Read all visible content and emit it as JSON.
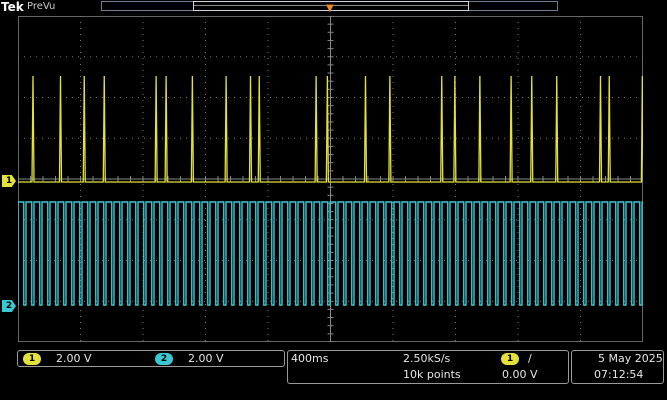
{
  "header": {
    "brand": "Tek",
    "mode": "PreVu"
  },
  "colors": {
    "ch1": "#e3e13a",
    "ch2": "#39c9d4",
    "trigger": "#f08a20",
    "grid": "#777777",
    "background": "#000000"
  },
  "icons": {
    "trigger_position": "trigger-marker-icon",
    "trigger_slope": "rising-edge-icon"
  },
  "channels": [
    {
      "number": "1",
      "scale": "2.00 V"
    },
    {
      "number": "2",
      "scale": "2.00 V"
    }
  ],
  "horizontal": {
    "time_per_div": "400ms",
    "sample_rate": "2.50kS/s",
    "record_length": "10k points"
  },
  "trigger": {
    "source": "1",
    "slope": "/",
    "level": "0.00 V"
  },
  "datetime": {
    "date": "5 May 2025",
    "time": "07:12:54"
  },
  "waveforms": {
    "ch1_pulse_positions": [
      0.024,
      0.068,
      0.106,
      0.138,
      0.221,
      0.237,
      0.279,
      0.333,
      0.372,
      0.386,
      0.477,
      0.495,
      0.556,
      0.595,
      0.678,
      0.699,
      0.739,
      0.789,
      0.822,
      0.862,
      0.932,
      0.946,
      0.999
    ],
    "ch2_period": 0.0128
  }
}
